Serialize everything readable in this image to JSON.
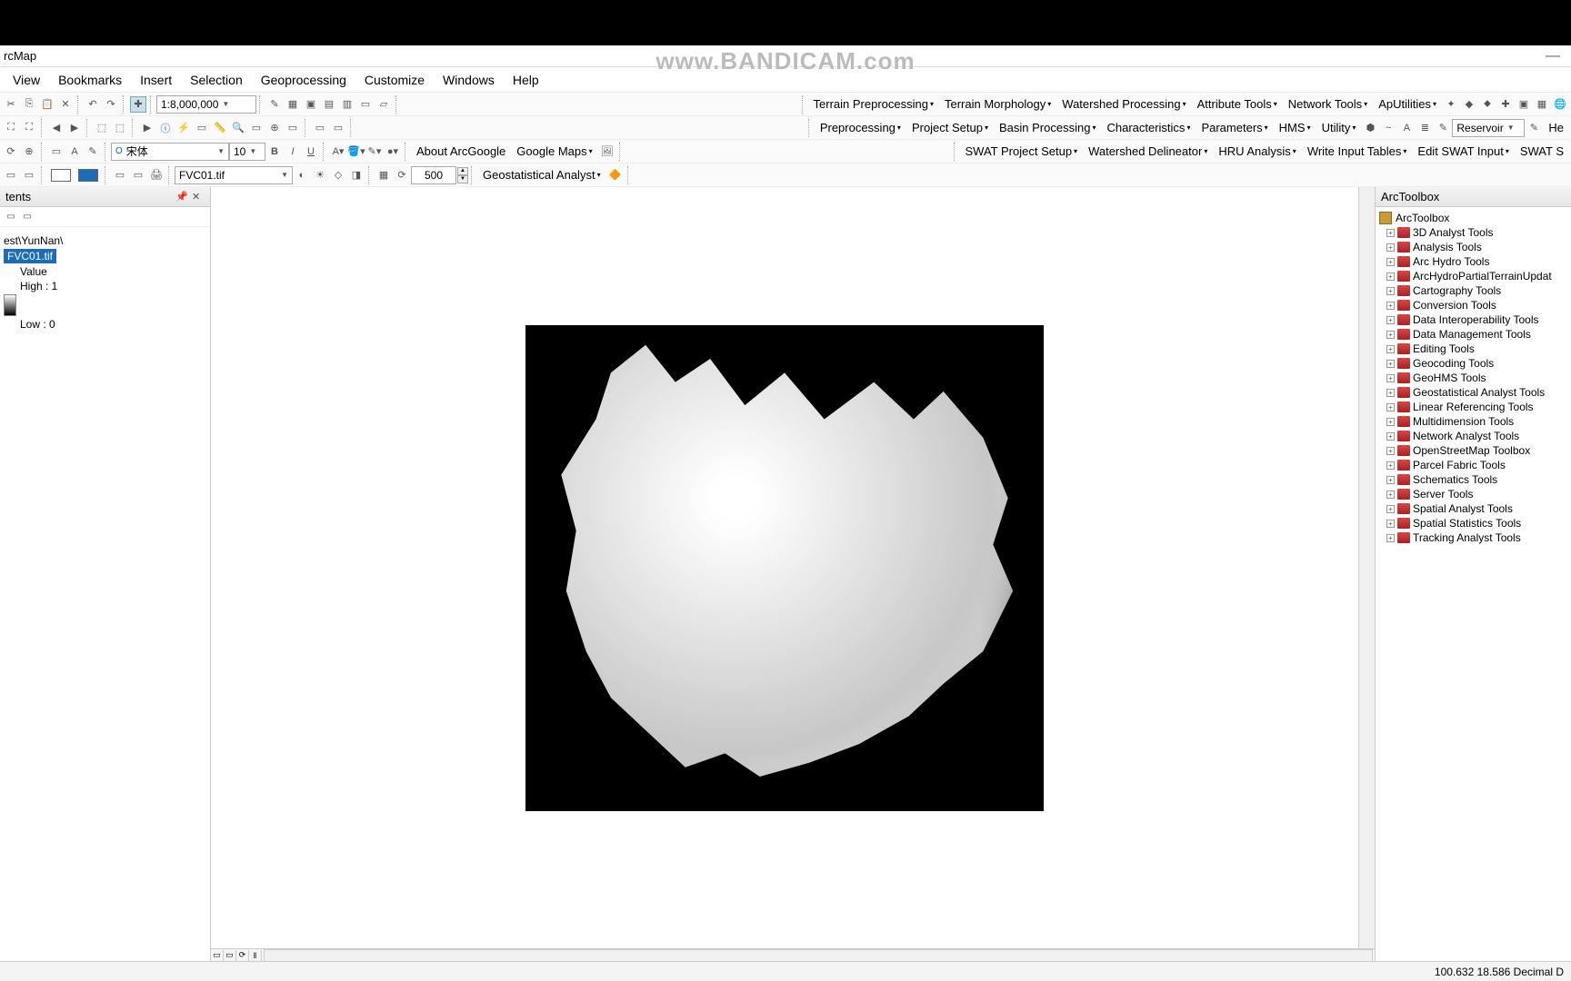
{
  "app": {
    "title": "rcMap"
  },
  "watermark": "www.BANDICAM.com",
  "menubar": [
    "View",
    "Bookmarks",
    "Insert",
    "Selection",
    "Geoprocessing",
    "Customize",
    "Windows",
    "Help"
  ],
  "toolbar1": {
    "scale": "1:8,000,000",
    "right_menus": [
      "Terrain Preprocessing",
      "Terrain Morphology",
      "Watershed Processing",
      "Attribute Tools",
      "Network Tools",
      "ApUtilities"
    ]
  },
  "toolbar2": {
    "right_menus": [
      "Preprocessing",
      "Project Setup",
      "Basin Processing",
      "Characteristics",
      "Parameters",
      "HMS",
      "Utility"
    ],
    "reservoir": "Reservoir",
    "he": "He"
  },
  "toolbar3": {
    "font": "宋体",
    "size": "10",
    "right_menus": [
      "About ArcGoogle",
      "Google Maps"
    ],
    "swat_menus": [
      "SWAT Project Setup",
      "Watershed Delineator",
      "HRU Analysis",
      "Write Input Tables",
      "Edit SWAT Input",
      "SWAT S"
    ]
  },
  "toolbar4": {
    "layer": "FVC01.tif",
    "transparency": "500",
    "geo": "Geostatistical Analyst"
  },
  "toc": {
    "title": "tents",
    "path": "est\\YunNan\\",
    "layer": "FVC01.tif",
    "value": "Value",
    "high": "High : 1",
    "low": "Low : 0"
  },
  "toolbox": {
    "title": "ArcToolbox",
    "root": "ArcToolbox",
    "items": [
      "3D Analyst Tools",
      "Analysis Tools",
      "Arc Hydro Tools",
      "ArcHydroPartialTerrainUpdat",
      "Cartography Tools",
      "Conversion Tools",
      "Data Interoperability Tools",
      "Data Management Tools",
      "Editing Tools",
      "Geocoding Tools",
      "GeoHMS Tools",
      "Geostatistical Analyst Tools",
      "Linear Referencing Tools",
      "Multidimension Tools",
      "Network Analyst Tools",
      "OpenStreetMap Toolbox",
      "Parcel Fabric Tools",
      "Schematics Tools",
      "Server Tools",
      "Spatial Analyst Tools",
      "Spatial Statistics Tools",
      "Tracking Analyst Tools"
    ]
  },
  "statusbar": {
    "coords": "100.632  18.586 Decimal D"
  }
}
